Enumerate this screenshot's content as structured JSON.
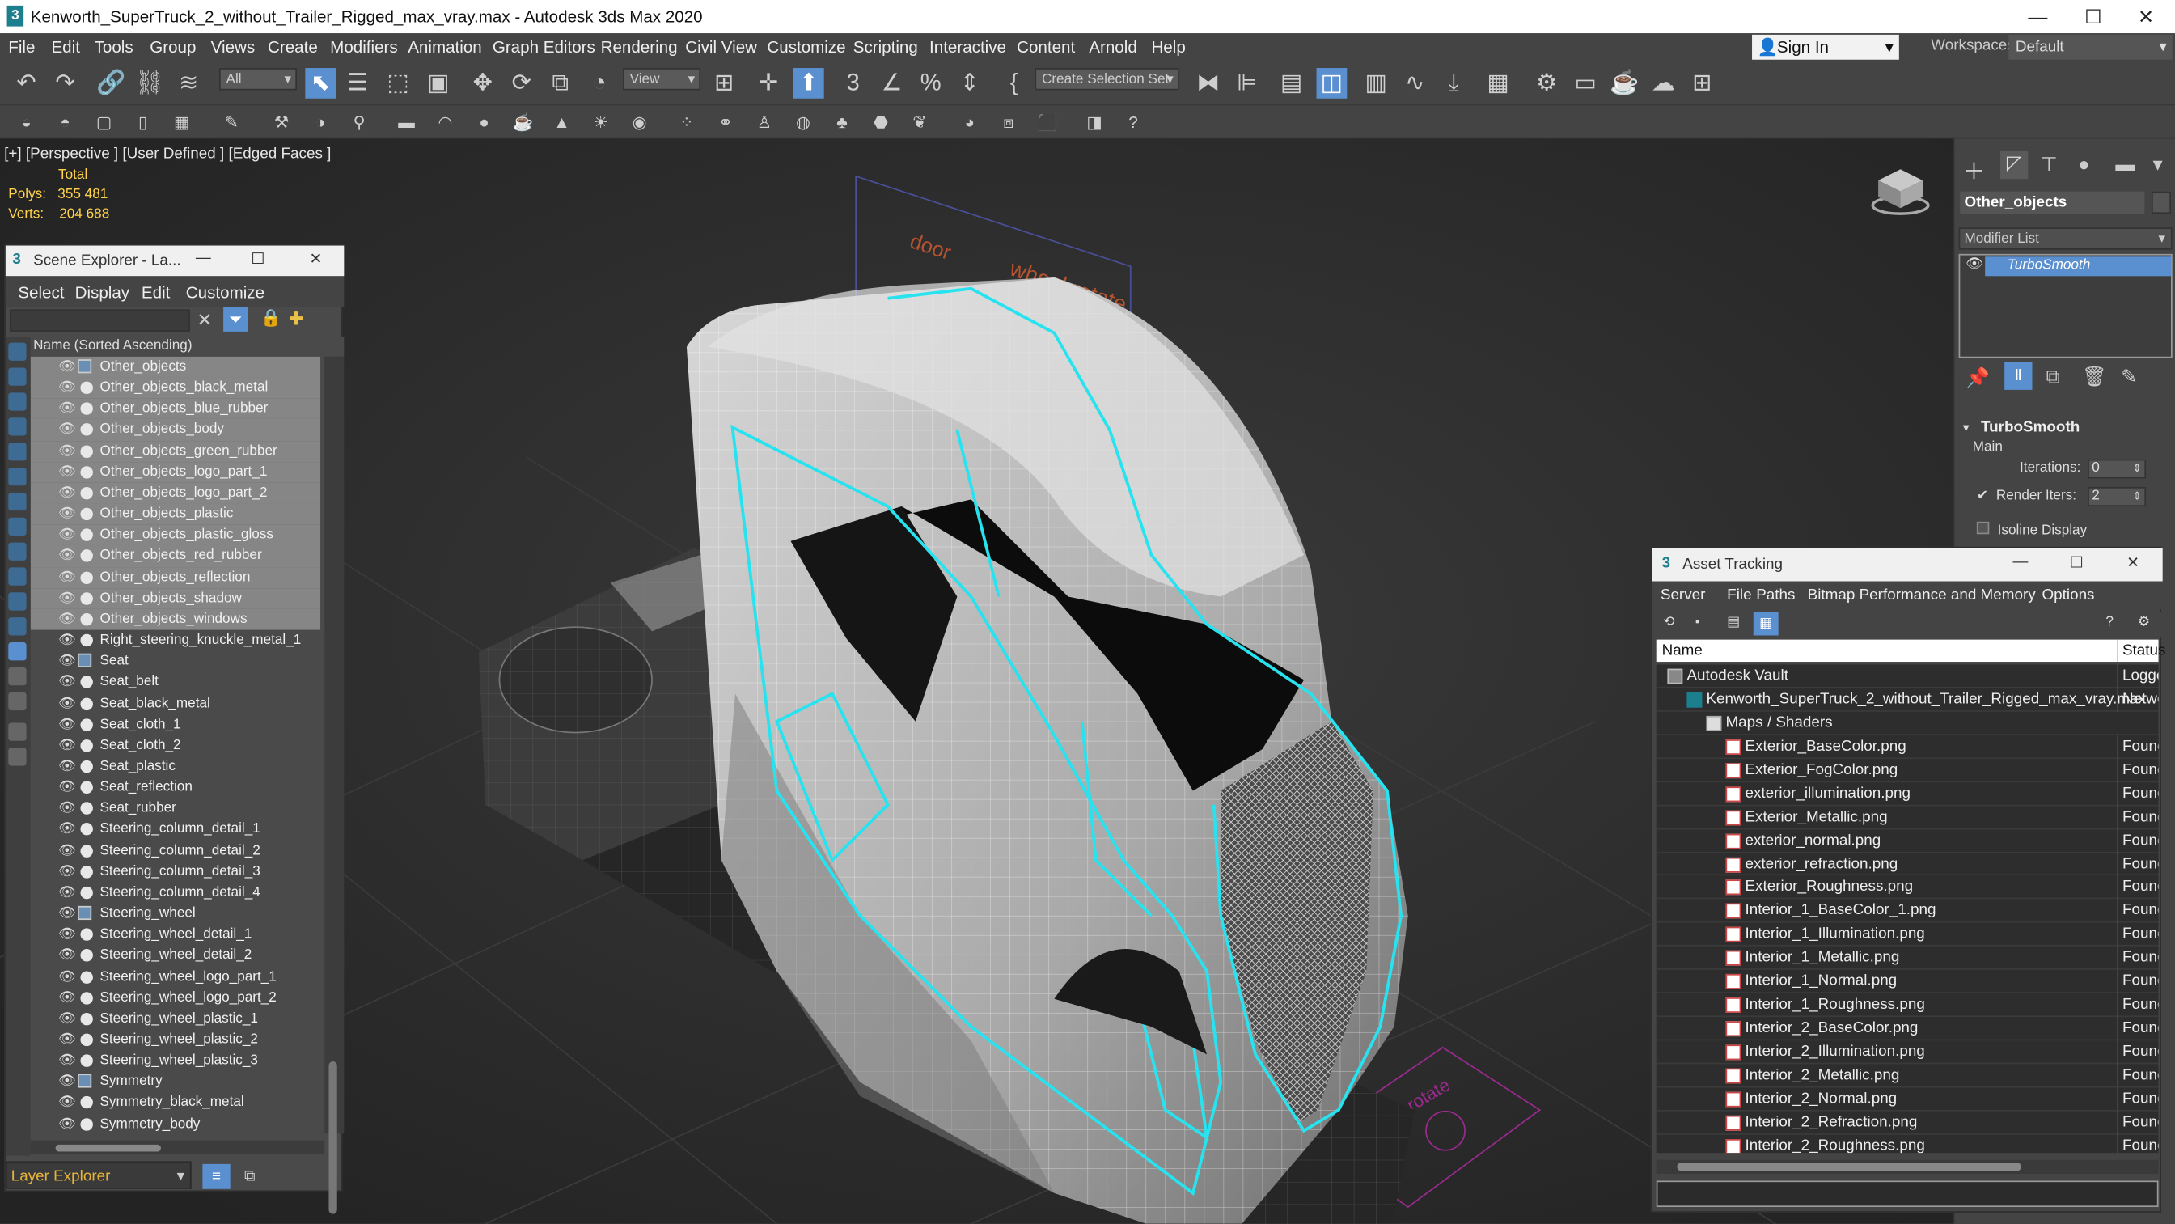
{
  "window": {
    "title": "Kenworth_SuperTruck_2_without_Trailer_Rigged_max_vray.max - Autodesk 3ds Max 2020"
  },
  "menubar": {
    "items": [
      "File",
      "Edit",
      "Tools",
      "Group",
      "Views",
      "Create",
      "Modifiers",
      "Animation",
      "Graph Editors",
      "Rendering",
      "Civil View",
      "Customize",
      "Scripting",
      "Interactive",
      "Content",
      "Arnold",
      "Help"
    ],
    "sign_in": "Sign In",
    "workspaces_label": "Workspaces:",
    "workspace_value": "Default"
  },
  "toolbar": {
    "filter_value": "All",
    "view_value": "View",
    "selection_set": "Create Selection Set"
  },
  "viewport": {
    "label": "[+] [Perspective ] [User Defined ] [Edged Faces ]",
    "stats_total": "Total",
    "polys_label": "Polys:",
    "polys_value": "355 481",
    "verts_label": "Verts:",
    "verts_value": "204 688"
  },
  "scene_explorer": {
    "title": "Scene Explorer - La...",
    "menus": [
      "Select",
      "Display",
      "Edit",
      "Customize"
    ],
    "column_header": "Name (Sorted Ascending)",
    "footer_label": "Layer Explorer",
    "rows": [
      {
        "name": "Other_objects",
        "group": true,
        "selected": true
      },
      {
        "name": "Other_objects_black_metal",
        "group": false,
        "selected": true
      },
      {
        "name": "Other_objects_blue_rubber",
        "group": false,
        "selected": true
      },
      {
        "name": "Other_objects_body",
        "group": false,
        "selected": true
      },
      {
        "name": "Other_objects_green_rubber",
        "group": false,
        "selected": true
      },
      {
        "name": "Other_objects_logo_part_1",
        "group": false,
        "selected": true
      },
      {
        "name": "Other_objects_logo_part_2",
        "group": false,
        "selected": true
      },
      {
        "name": "Other_objects_plastic",
        "group": false,
        "selected": true
      },
      {
        "name": "Other_objects_plastic_gloss",
        "group": false,
        "selected": true
      },
      {
        "name": "Other_objects_red_rubber",
        "group": false,
        "selected": true
      },
      {
        "name": "Other_objects_reflection",
        "group": false,
        "selected": true
      },
      {
        "name": "Other_objects_shadow",
        "group": false,
        "selected": true
      },
      {
        "name": "Other_objects_windows",
        "group": false,
        "selected": true
      },
      {
        "name": "Right_steering_knuckle_metal_1",
        "group": false,
        "selected": false
      },
      {
        "name": "Seat",
        "group": true,
        "selected": false
      },
      {
        "name": "Seat_belt",
        "group": false,
        "selected": false
      },
      {
        "name": "Seat_black_metal",
        "group": false,
        "selected": false
      },
      {
        "name": "Seat_cloth_1",
        "group": false,
        "selected": false
      },
      {
        "name": "Seat_cloth_2",
        "group": false,
        "selected": false
      },
      {
        "name": "Seat_plastic",
        "group": false,
        "selected": false
      },
      {
        "name": "Seat_reflection",
        "group": false,
        "selected": false
      },
      {
        "name": "Seat_rubber",
        "group": false,
        "selected": false
      },
      {
        "name": "Steering_column_detail_1",
        "group": false,
        "selected": false
      },
      {
        "name": "Steering_column_detail_2",
        "group": false,
        "selected": false
      },
      {
        "name": "Steering_column_detail_3",
        "group": false,
        "selected": false
      },
      {
        "name": "Steering_column_detail_4",
        "group": false,
        "selected": false
      },
      {
        "name": "Steering_wheel",
        "group": true,
        "selected": false
      },
      {
        "name": "Steering_wheel_detail_1",
        "group": false,
        "selected": false
      },
      {
        "name": "Steering_wheel_detail_2",
        "group": false,
        "selected": false
      },
      {
        "name": "Steering_wheel_logo_part_1",
        "group": false,
        "selected": false
      },
      {
        "name": "Steering_wheel_logo_part_2",
        "group": false,
        "selected": false
      },
      {
        "name": "Steering_wheel_plastic_1",
        "group": false,
        "selected": false
      },
      {
        "name": "Steering_wheel_plastic_2",
        "group": false,
        "selected": false
      },
      {
        "name": "Steering_wheel_plastic_3",
        "group": false,
        "selected": false
      },
      {
        "name": "Symmetry",
        "group": true,
        "selected": false
      },
      {
        "name": "Symmetry_black_metal",
        "group": false,
        "selected": false
      },
      {
        "name": "Symmetry_body",
        "group": false,
        "selected": false
      }
    ]
  },
  "command_panel": {
    "object_name": "Other_objects",
    "modifier_list": "Modifier List",
    "modifier": "TurboSmooth",
    "rollout_title": "TurboSmooth",
    "main_label": "Main",
    "iterations_label": "Iterations:",
    "iterations_value": "0",
    "render_iters_label": "Render Iters:",
    "render_iters_value": "2",
    "isoline_label": "Isoline Display"
  },
  "asset_tracking": {
    "title": "Asset Tracking",
    "menus": [
      "Server",
      "File",
      "Paths",
      "Bitmap Performance and Memory",
      "Options"
    ],
    "col_name": "Name",
    "col_status": "Status",
    "rows": [
      {
        "name": "Autodesk Vault",
        "status": "Logge",
        "indent": 1,
        "kind": "vault"
      },
      {
        "name": "Kenworth_SuperTruck_2_without_Trailer_Rigged_max_vray.max",
        "status": "Netwo",
        "indent": 2,
        "kind": "max"
      },
      {
        "name": "Maps / Shaders",
        "status": "",
        "indent": 3,
        "kind": "folder"
      },
      {
        "name": "Exterior_BaseColor.png",
        "status": "Found",
        "indent": 4,
        "kind": "file"
      },
      {
        "name": "Exterior_FogColor.png",
        "status": "Found",
        "indent": 4,
        "kind": "file"
      },
      {
        "name": "exterior_illumination.png",
        "status": "Found",
        "indent": 4,
        "kind": "file"
      },
      {
        "name": "Exterior_Metallic.png",
        "status": "Found",
        "indent": 4,
        "kind": "file"
      },
      {
        "name": "exterior_normal.png",
        "status": "Found",
        "indent": 4,
        "kind": "file"
      },
      {
        "name": "exterior_refraction.png",
        "status": "Found",
        "indent": 4,
        "kind": "file"
      },
      {
        "name": "Exterior_Roughness.png",
        "status": "Found",
        "indent": 4,
        "kind": "file"
      },
      {
        "name": "Interior_1_BaseColor_1.png",
        "status": "Found",
        "indent": 4,
        "kind": "file"
      },
      {
        "name": "Interior_1_Illumination.png",
        "status": "Found",
        "indent": 4,
        "kind": "file"
      },
      {
        "name": "Interior_1_Metallic.png",
        "status": "Found",
        "indent": 4,
        "kind": "file"
      },
      {
        "name": "Interior_1_Normal.png",
        "status": "Found",
        "indent": 4,
        "kind": "file"
      },
      {
        "name": "Interior_1_Roughness.png",
        "status": "Found",
        "indent": 4,
        "kind": "file"
      },
      {
        "name": "Interior_2_BaseColor.png",
        "status": "Found",
        "indent": 4,
        "kind": "file"
      },
      {
        "name": "Interior_2_Illumination.png",
        "status": "Found",
        "indent": 4,
        "kind": "file"
      },
      {
        "name": "Interior_2_Metallic.png",
        "status": "Found",
        "indent": 4,
        "kind": "file"
      },
      {
        "name": "Interior_2_Normal.png",
        "status": "Found",
        "indent": 4,
        "kind": "file"
      },
      {
        "name": "Interior_2_Refraction.png",
        "status": "Found",
        "indent": 4,
        "kind": "file"
      },
      {
        "name": "Interior_2_Roughness.png",
        "status": "Found",
        "indent": 4,
        "kind": "file"
      }
    ]
  },
  "helpers": {
    "door_label": "door",
    "wheel_rotate_label": "wheel rotate",
    "wheel_label": "wheel rotate"
  },
  "colors": {
    "accent": "#5a8fd0",
    "selection": "#00e5ff",
    "stats": "#ffd24a"
  }
}
